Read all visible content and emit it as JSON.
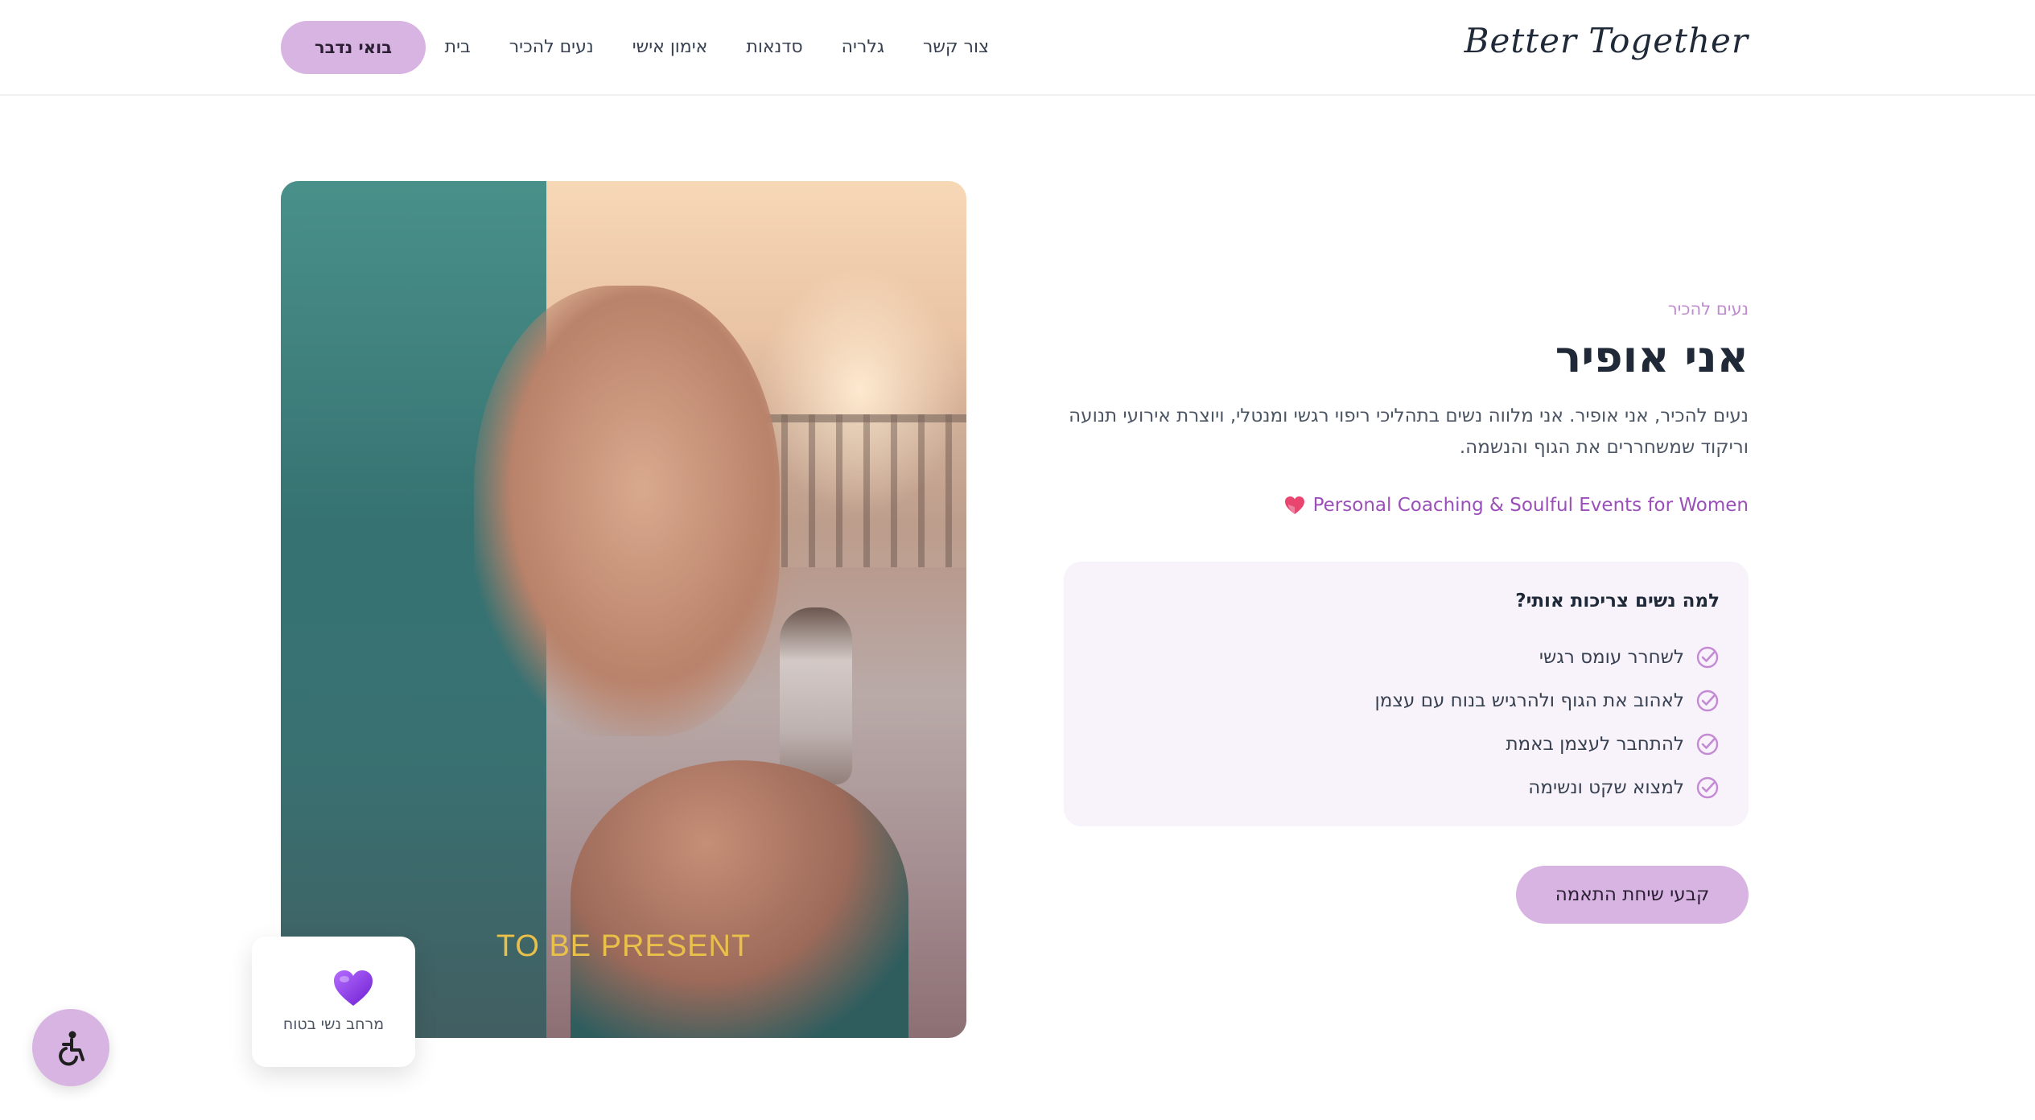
{
  "header": {
    "logo": "Better Together",
    "nav": [
      {
        "id": "home",
        "label": "בית"
      },
      {
        "id": "about",
        "label": "נעים להכיר"
      },
      {
        "id": "coaching",
        "label": "אימון אישי"
      },
      {
        "id": "workshops",
        "label": "סדנאות"
      },
      {
        "id": "gallery",
        "label": "גלריה"
      },
      {
        "id": "contact",
        "label": "צור קשר"
      }
    ],
    "cta_label": "בואי נדבר"
  },
  "hero_image": {
    "caption": "TO BE PRESENT"
  },
  "float_card": {
    "icon": "purple-heart-icon",
    "label": "מרחב נשי בטוח"
  },
  "about": {
    "eyebrow": "נעים להכיר",
    "title": "אני אופיר",
    "description": "נעים להכיר, אני אופיר. אני מלווה נשים בתהליכי ריפוי רגשי ומנטלי, ויוצרת אירועי תנועה וריקוד שמשחררים את הגוף והנשמה.",
    "tagline": "Personal Coaching & Soulful Events for Women"
  },
  "why": {
    "title": "למה נשים צריכות אותי?",
    "items": [
      "לשחרר עומס רגשי",
      "לאהוב את הגוף ולהרגיש בנוח עם עצמן",
      "להתחבר לעצמן באמת",
      "למצוא שקט ונשימה"
    ]
  },
  "cta_main_label": "קבעי שיחת התאמה",
  "colors": {
    "accent": "#d8b4e2",
    "accent_text": "#9b4fb8",
    "card_bg": "#f8f2fa"
  }
}
